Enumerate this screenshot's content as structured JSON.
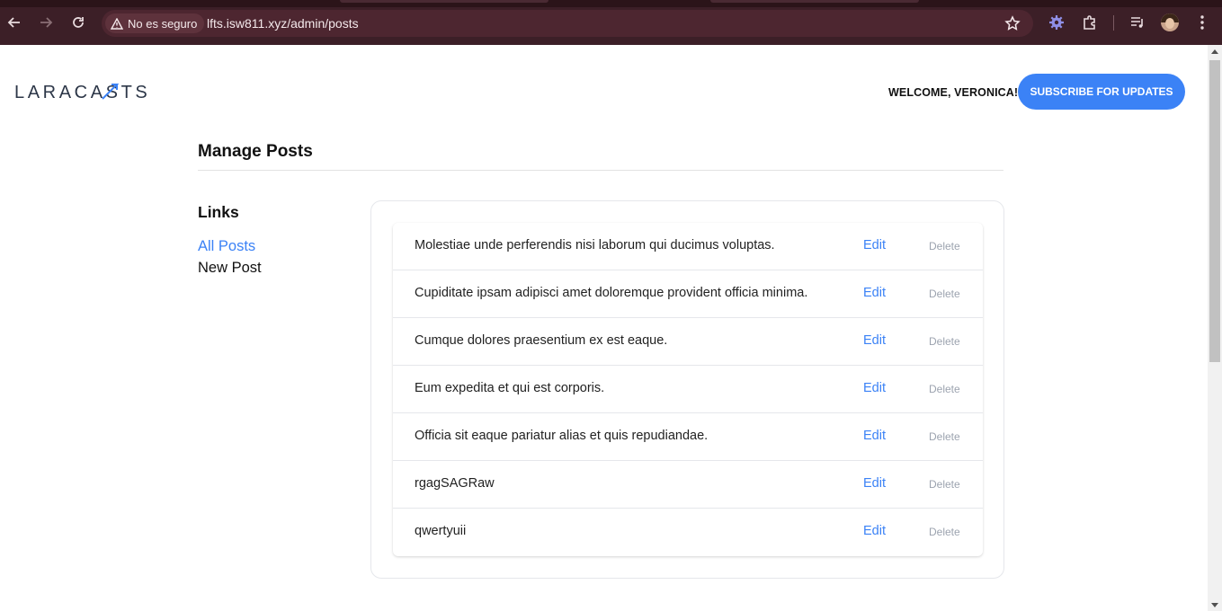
{
  "browser": {
    "security_label": "No es seguro",
    "url": "lfts.isw811.xyz/admin/posts"
  },
  "header": {
    "logo_text": "LARACASTS",
    "welcome": "WELCOME, VERONICA!",
    "subscribe_label": "SUBSCRIBE FOR UPDATES"
  },
  "main": {
    "title": "Manage Posts",
    "links_heading": "Links",
    "links": [
      {
        "label": "All Posts",
        "active": true
      },
      {
        "label": "New Post",
        "active": false
      }
    ],
    "edit_label": "Edit",
    "delete_label": "Delete",
    "posts": [
      {
        "title": "Molestiae unde perferendis nisi laborum qui ducimus voluptas."
      },
      {
        "title": "Cupiditate ipsam adipisci amet doloremque provident officia minima."
      },
      {
        "title": "Cumque dolores praesentium ex est eaque."
      },
      {
        "title": "Eum expedita et qui est corporis."
      },
      {
        "title": "Officia sit eaque pariatur alias et quis repudiandae."
      },
      {
        "title": "rgagSAGRaw"
      },
      {
        "title": "qwertyuii"
      }
    ]
  },
  "colors": {
    "accent": "#3b82f6",
    "chrome_bg": "#3c1f27"
  },
  "icons": [
    "back-arrow-icon",
    "forward-arrow-icon",
    "reload-icon",
    "warning-icon",
    "star-icon",
    "extension-gear-icon",
    "puzzle-icon",
    "media-queue-icon",
    "menu-dots-icon"
  ]
}
